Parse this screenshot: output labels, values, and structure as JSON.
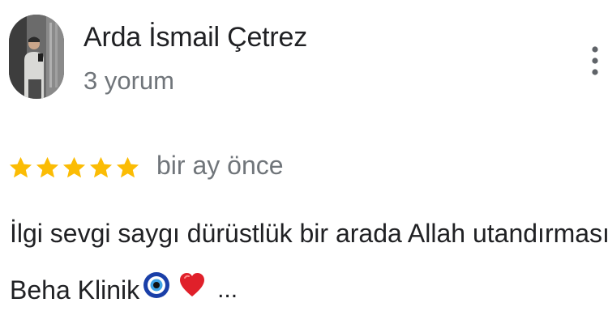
{
  "review": {
    "author": {
      "name": "Arda İsmail Çetrez",
      "review_count": "3 yorum",
      "avatar_icon": "profile-photo"
    },
    "rating": 5,
    "rating_max": 5,
    "star_color": "#fbbc04",
    "time": "bir ay önce",
    "text_line_1": "İlgi sevgi saygı dürüstlük bir arada Allah utandırmasın",
    "text_line_2": "Beha Klinik",
    "emojis": [
      "nazar-amulet-emoji",
      "red-heart-emoji"
    ],
    "more_label": "...",
    "menu_icon": "vertical-dots-icon"
  }
}
